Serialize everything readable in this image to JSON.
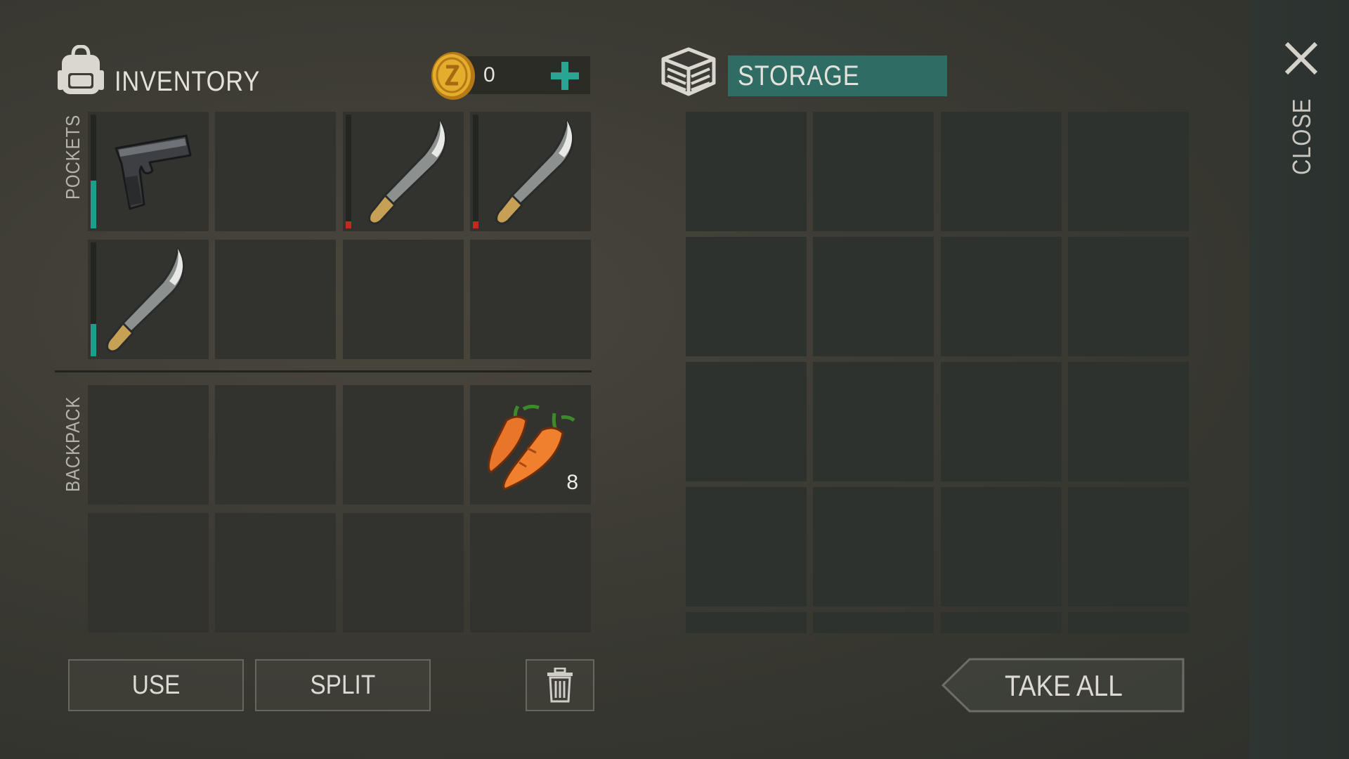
{
  "inventory": {
    "title": "INVENTORY",
    "coins": "0",
    "add_icon": "plus-icon",
    "pockets_label": "POCKETS",
    "backpack_label": "BACKPACK",
    "pockets": [
      {
        "item": "pistol",
        "durability": 0.42,
        "durability_color": "#1e9c8c"
      },
      {
        "item": null
      },
      {
        "item": "machete",
        "durability": 0.05,
        "durability_color": "#c22a1e"
      },
      {
        "item": "machete",
        "durability": 0.05,
        "durability_color": "#c22a1e"
      },
      {
        "item": "machete",
        "durability": 0.28,
        "durability_color": "#1e9c8c"
      },
      {
        "item": null
      },
      {
        "item": null
      },
      {
        "item": null
      }
    ],
    "backpack": [
      {
        "item": null
      },
      {
        "item": null
      },
      {
        "item": null
      },
      {
        "item": "carrots",
        "count": "8"
      },
      {
        "item": null
      },
      {
        "item": null
      },
      {
        "item": null
      },
      {
        "item": null
      }
    ]
  },
  "storage": {
    "title": "STORAGE",
    "icon": "crate-icon",
    "slots_visible": 16,
    "header_color": "#2e6c64"
  },
  "actions": {
    "use_label": "USE",
    "split_label": "SPLIT",
    "trash_icon": "trash-icon",
    "take_all_label": "TAKE ALL",
    "close_label": "CLOSE"
  }
}
